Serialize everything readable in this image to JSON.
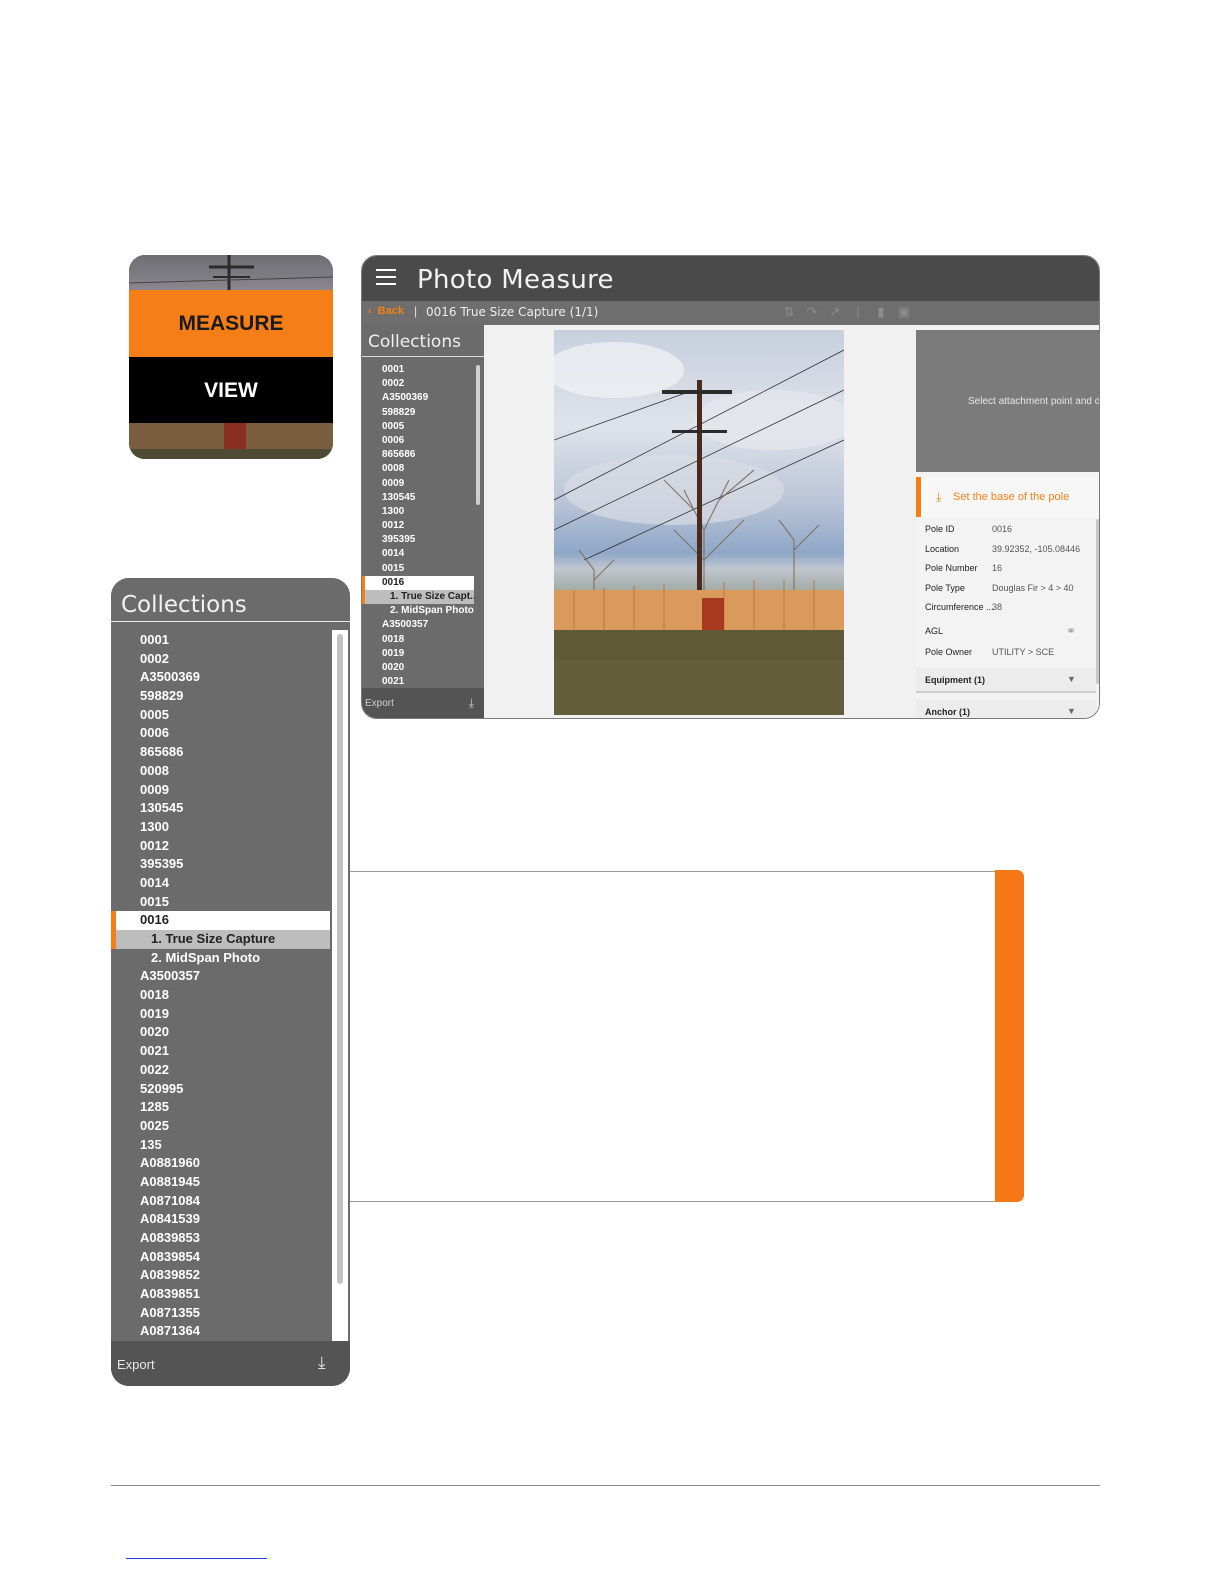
{
  "mode_card": {
    "measure_label": "MEASURE",
    "view_label": "VIEW"
  },
  "app": {
    "title": "Photo Measure",
    "toolbar": {
      "back_label": "Back",
      "separator": "|",
      "capture_title": "0016 True Size Capture (1/1)"
    },
    "sidebar": {
      "title": "Collections",
      "items": [
        "0001",
        "0002",
        "A3500369",
        "598829",
        "0005",
        "0006",
        "865686",
        "0008",
        "0009",
        "130545",
        "1300",
        "0012",
        "395395",
        "0014",
        "0015",
        "0016",
        "1. True Size Capt...",
        "2. MidSpan Photo",
        "A3500357",
        "0018",
        "0019",
        "0020",
        "0021"
      ],
      "export_label": "Export"
    },
    "right_panel": {
      "hint": "Select attachment point and dr",
      "step_label": "Set the base of the pole",
      "properties": [
        {
          "key": "Pole ID",
          "value": "0016"
        },
        {
          "key": "Location",
          "value": "39.92352, -105.08446"
        },
        {
          "key": "Pole Number",
          "value": "16"
        },
        {
          "key": "Pole Type",
          "value": "Douglas Fir > 4 > 40"
        },
        {
          "key": "Circumference ...",
          "value": "38"
        }
      ],
      "agl_label": "AGL",
      "pole_owner_label": "Pole Owner",
      "pole_owner_value": "UTILITY > SCE",
      "equipment_label": "Equipment (1)",
      "anchor_label": "Anchor (1)"
    }
  },
  "collections_panel": {
    "title": "Collections",
    "items": [
      "0001",
      "0002",
      "A3500369",
      "598829",
      "0005",
      "0006",
      "865686",
      "0008",
      "0009",
      "130545",
      "1300",
      "0012",
      "395395",
      "0014",
      "0015",
      "0016",
      "1. True Size Capture",
      "2. MidSpan Photo",
      "A3500357",
      "0018",
      "0019",
      "0020",
      "0021",
      "0022",
      "520995",
      "1285",
      "0025",
      "135",
      "A0881960",
      "A0881945",
      "A0871084",
      "A0841539",
      "A0839853",
      "A0839854",
      "A0839852",
      "A0839851",
      "A0871355",
      "A0871364"
    ],
    "export_label": "Export"
  },
  "colors": {
    "accent": "#f57f16",
    "panel_gray": "#6b6b6b",
    "header_gray": "#4a4a4a"
  },
  "icons": {
    "menu": "hamburger-icon",
    "back": "chevron-left-icon",
    "download": "download-icon",
    "link": "link-icon",
    "expand": "caret-down-icon"
  }
}
